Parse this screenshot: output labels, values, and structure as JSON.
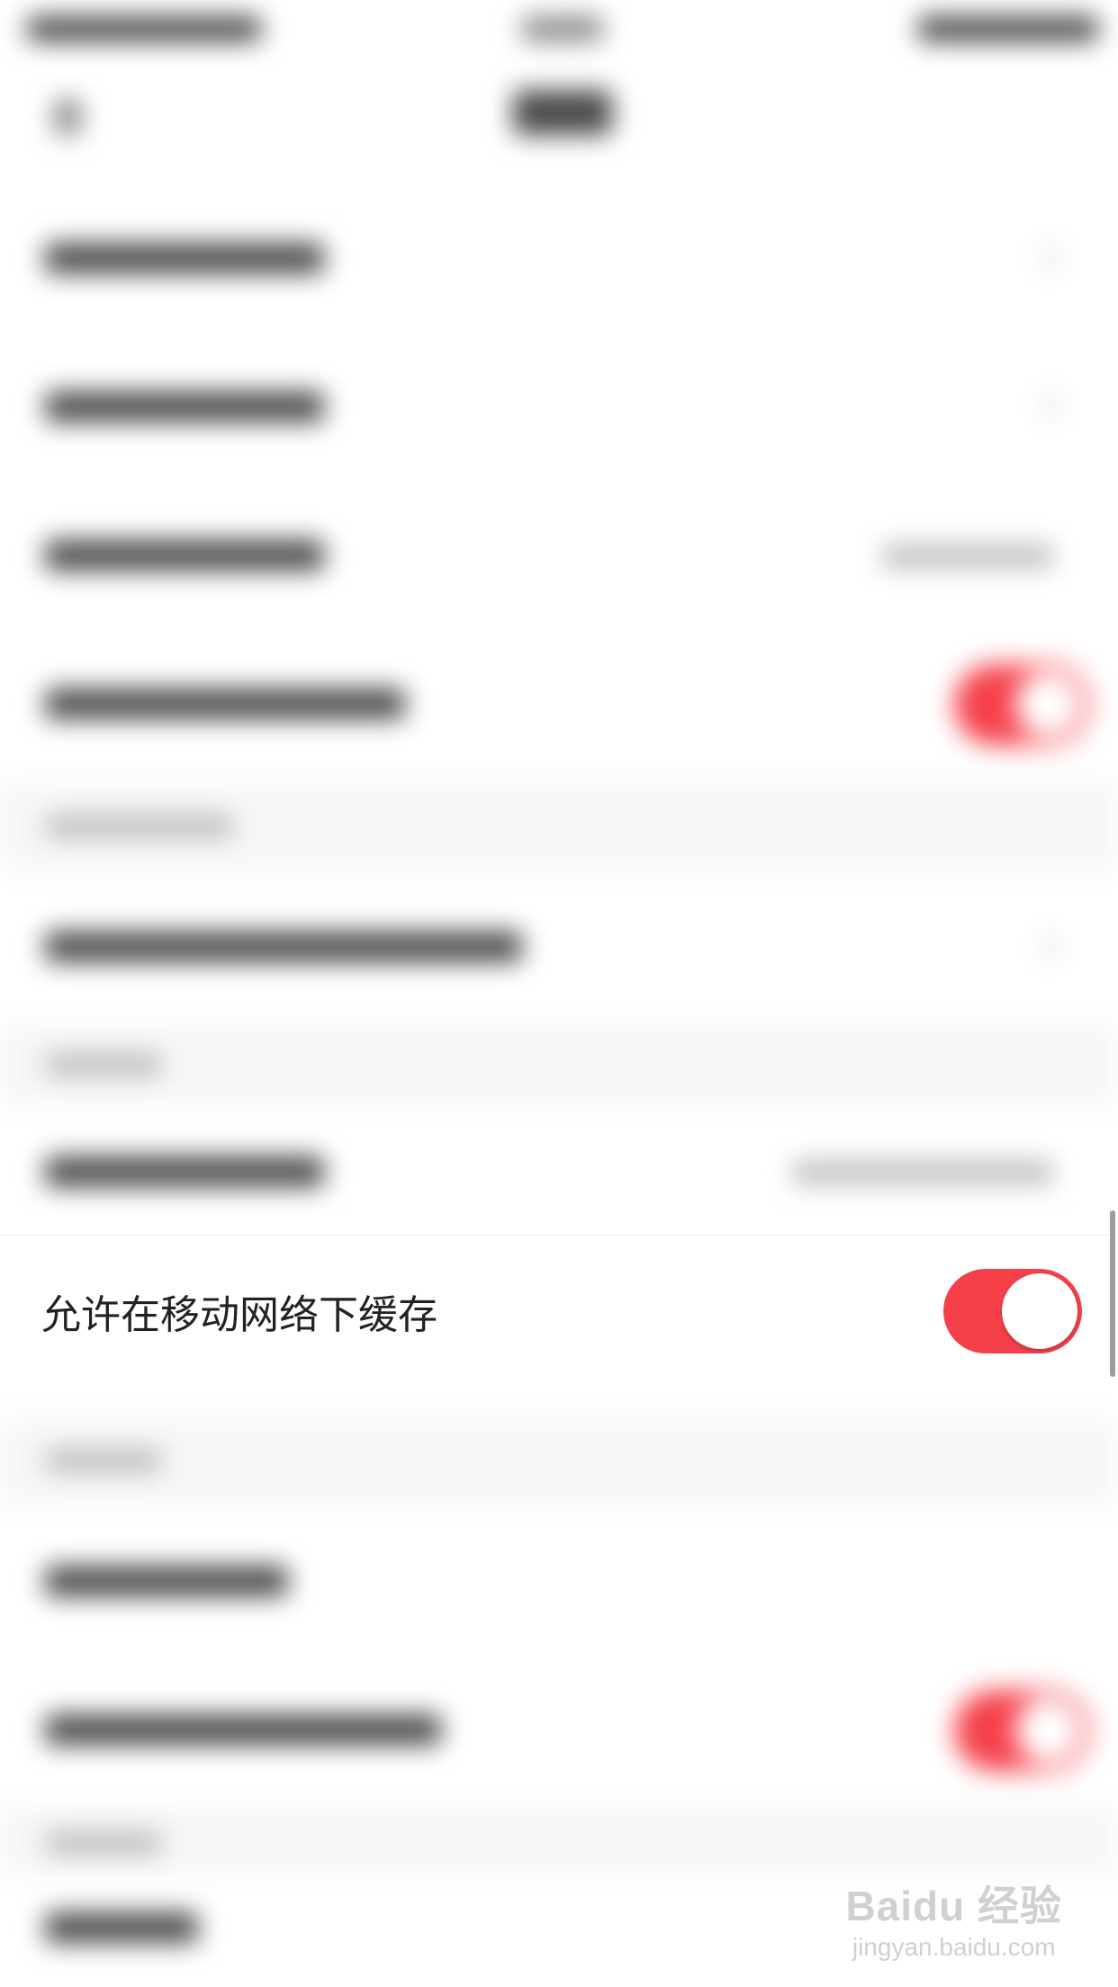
{
  "setting": {
    "label": "允许在移动网络下缓存",
    "enabled": true
  },
  "colors": {
    "accent": "#f5404a",
    "background": "#ffffff",
    "section_background": "#f7f7f7"
  },
  "watermark": {
    "logo": "Baidu 经验",
    "url": "jingyan.baidu.com"
  }
}
